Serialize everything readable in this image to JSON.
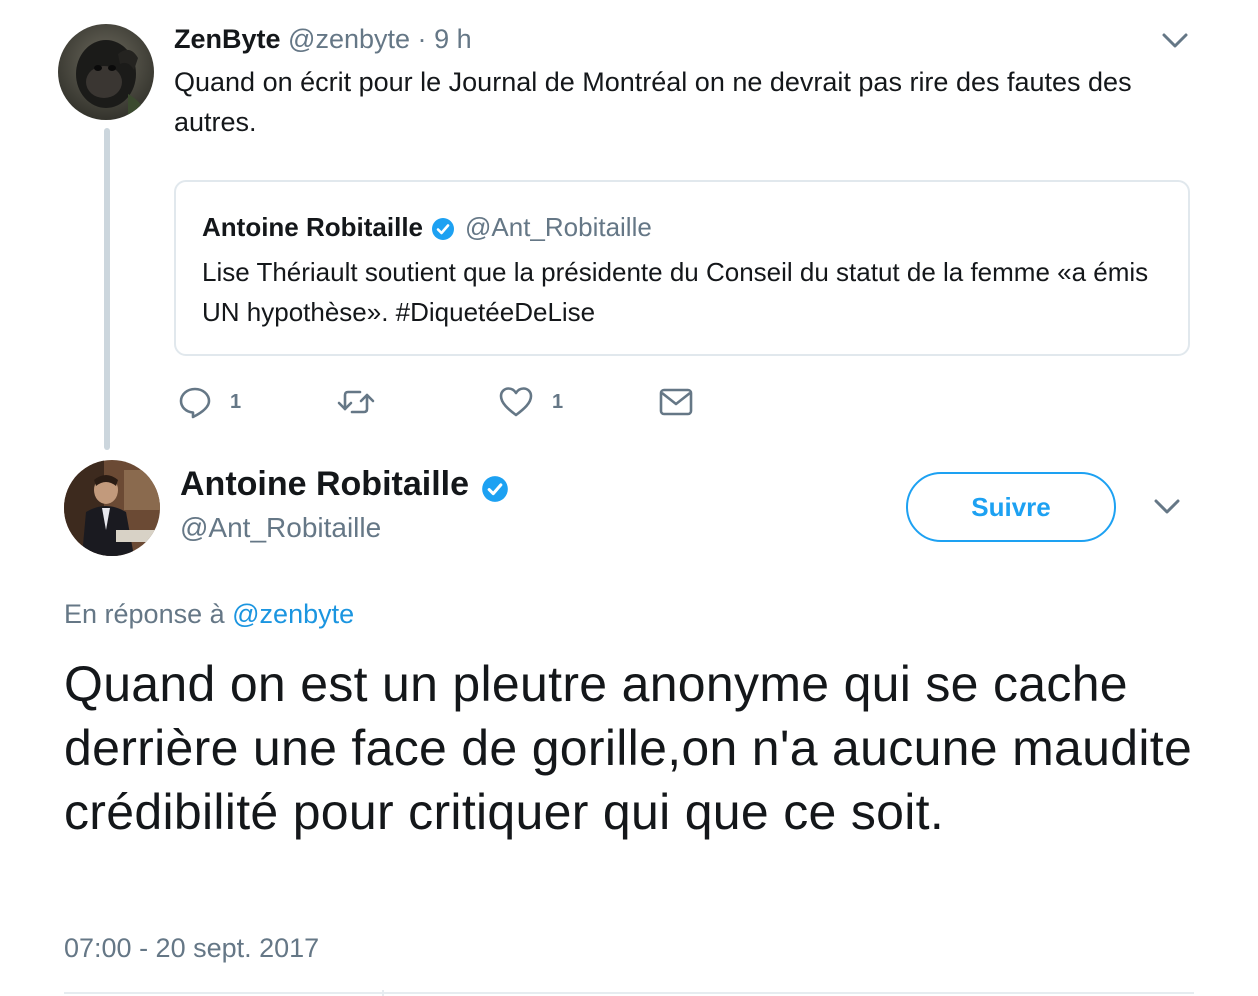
{
  "colors": {
    "accent": "#1da1f2",
    "text": "#14171a",
    "secondary": "#657786",
    "border": "#e1e8ed",
    "thread_line": "#ccd6dd"
  },
  "parent_tweet": {
    "name": "ZenByte",
    "handle": "@zenbyte",
    "separator": "·",
    "time": "9 h",
    "text": "Quand on écrit pour le Journal de Montréal on ne devrait pas rire des fautes des autres.",
    "avatar_icon": "gorilla-avatar",
    "quoted": {
      "name": "Antoine Robitaille",
      "handle": "@Ant_Robitaille",
      "verified_icon": "verified-badge-icon",
      "text": "Lise Thériault soutient que la présidente du Conseil du statut de la femme «a émis UN hypothèse». #DiquetéeDeLise"
    },
    "actions": {
      "reply_icon": "reply-icon",
      "reply_count": "1",
      "retweet_icon": "retweet-icon",
      "like_icon": "heart-icon",
      "like_count": "1",
      "dm_icon": "envelope-icon"
    }
  },
  "main_tweet": {
    "name": "Antoine Robitaille",
    "handle": "@Ant_Robitaille",
    "follow_label": "Suivre",
    "reply_prefix": "En réponse à",
    "reply_mention": "@zenbyte",
    "text": "Quand on est un pleutre anonyme qui se cache derrière une face de gorille,on n'a aucune maudite crédibilité pour critiquer qui que ce soit.",
    "timestamp": "07:00 - 20 sept. 2017"
  }
}
